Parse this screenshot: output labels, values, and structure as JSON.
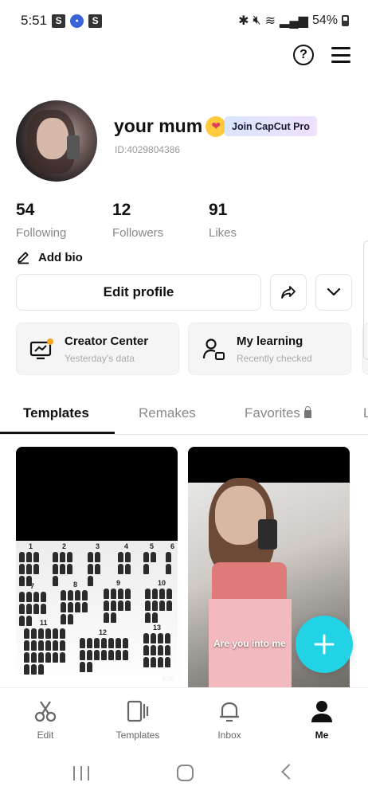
{
  "status_bar": {
    "time": "5:51",
    "badges": [
      "S",
      "S"
    ],
    "battery": "54%"
  },
  "profile": {
    "username": "your mum",
    "emoji": "kissing-face",
    "pro_badge": "Join CapCut Pro",
    "id_text": "ID:4029804386",
    "add_bio": "Add bio",
    "edit_profile": "Edit profile"
  },
  "stats": [
    {
      "value": "54",
      "label": "Following"
    },
    {
      "value": "12",
      "label": "Followers"
    },
    {
      "value": "91",
      "label": "Likes"
    }
  ],
  "cards": [
    {
      "title": "Creator Center",
      "subtitle": "Yesterday's data",
      "icon": "creator-monitor-icon"
    },
    {
      "title": "My learning",
      "subtitle": "Recently checked",
      "icon": "learning-person-icon"
    }
  ],
  "tabs": [
    {
      "label": "Templates",
      "active": true
    },
    {
      "label": "Remakes",
      "active": false
    },
    {
      "label": "Favorites",
      "active": false,
      "locked": true
    },
    {
      "label": "L",
      "active": false
    }
  ],
  "thumbnails": [
    {
      "numbers": [
        "1",
        "2",
        "3",
        "4",
        "5",
        "6",
        "7",
        "8",
        "9",
        "10",
        "11",
        "12",
        "13"
      ],
      "time": "9:46"
    },
    {
      "caption": "Are you into me"
    }
  ],
  "bottom_nav": [
    {
      "label": "Edit",
      "icon": "scissors-icon",
      "active": false
    },
    {
      "label": "Templates",
      "icon": "templates-icon",
      "active": false
    },
    {
      "label": "Inbox",
      "icon": "bell-icon",
      "active": false
    },
    {
      "label": "Me",
      "icon": "person-icon",
      "active": true
    }
  ],
  "colors": {
    "accent": "#22d3e6",
    "creator_dot": "#f5a623"
  }
}
